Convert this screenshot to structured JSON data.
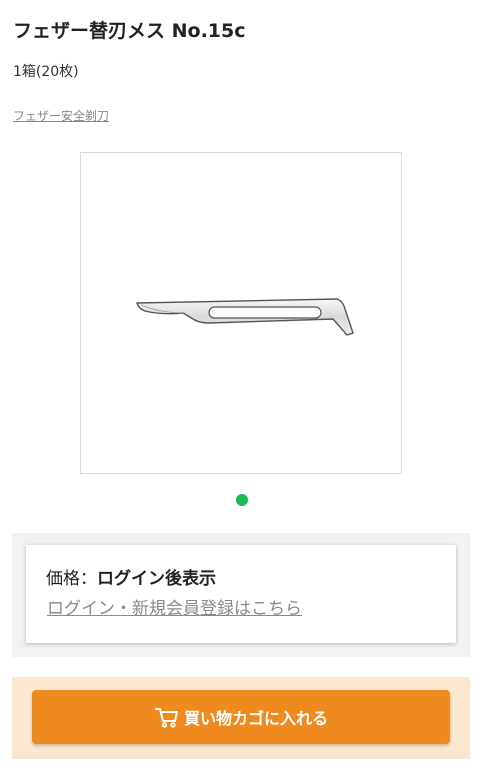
{
  "product": {
    "title": "フェザー替刃メス No.15c",
    "quantity": "1箱(20枚)",
    "brand_link": "フェザー安全剃刀",
    "image_icon": "scalpel-blade",
    "carousel": {
      "active_index": 0,
      "dot_color": "#1db954"
    }
  },
  "price": {
    "label": "価格：",
    "value": "ログイン後表示",
    "login_link": "ログイン・新規会員登録はこちら"
  },
  "cart": {
    "button_label": "買い物カゴに入れる",
    "icon": "cart-icon",
    "button_color": "#ef8a1e",
    "panel_color": "#fbe6cf"
  }
}
